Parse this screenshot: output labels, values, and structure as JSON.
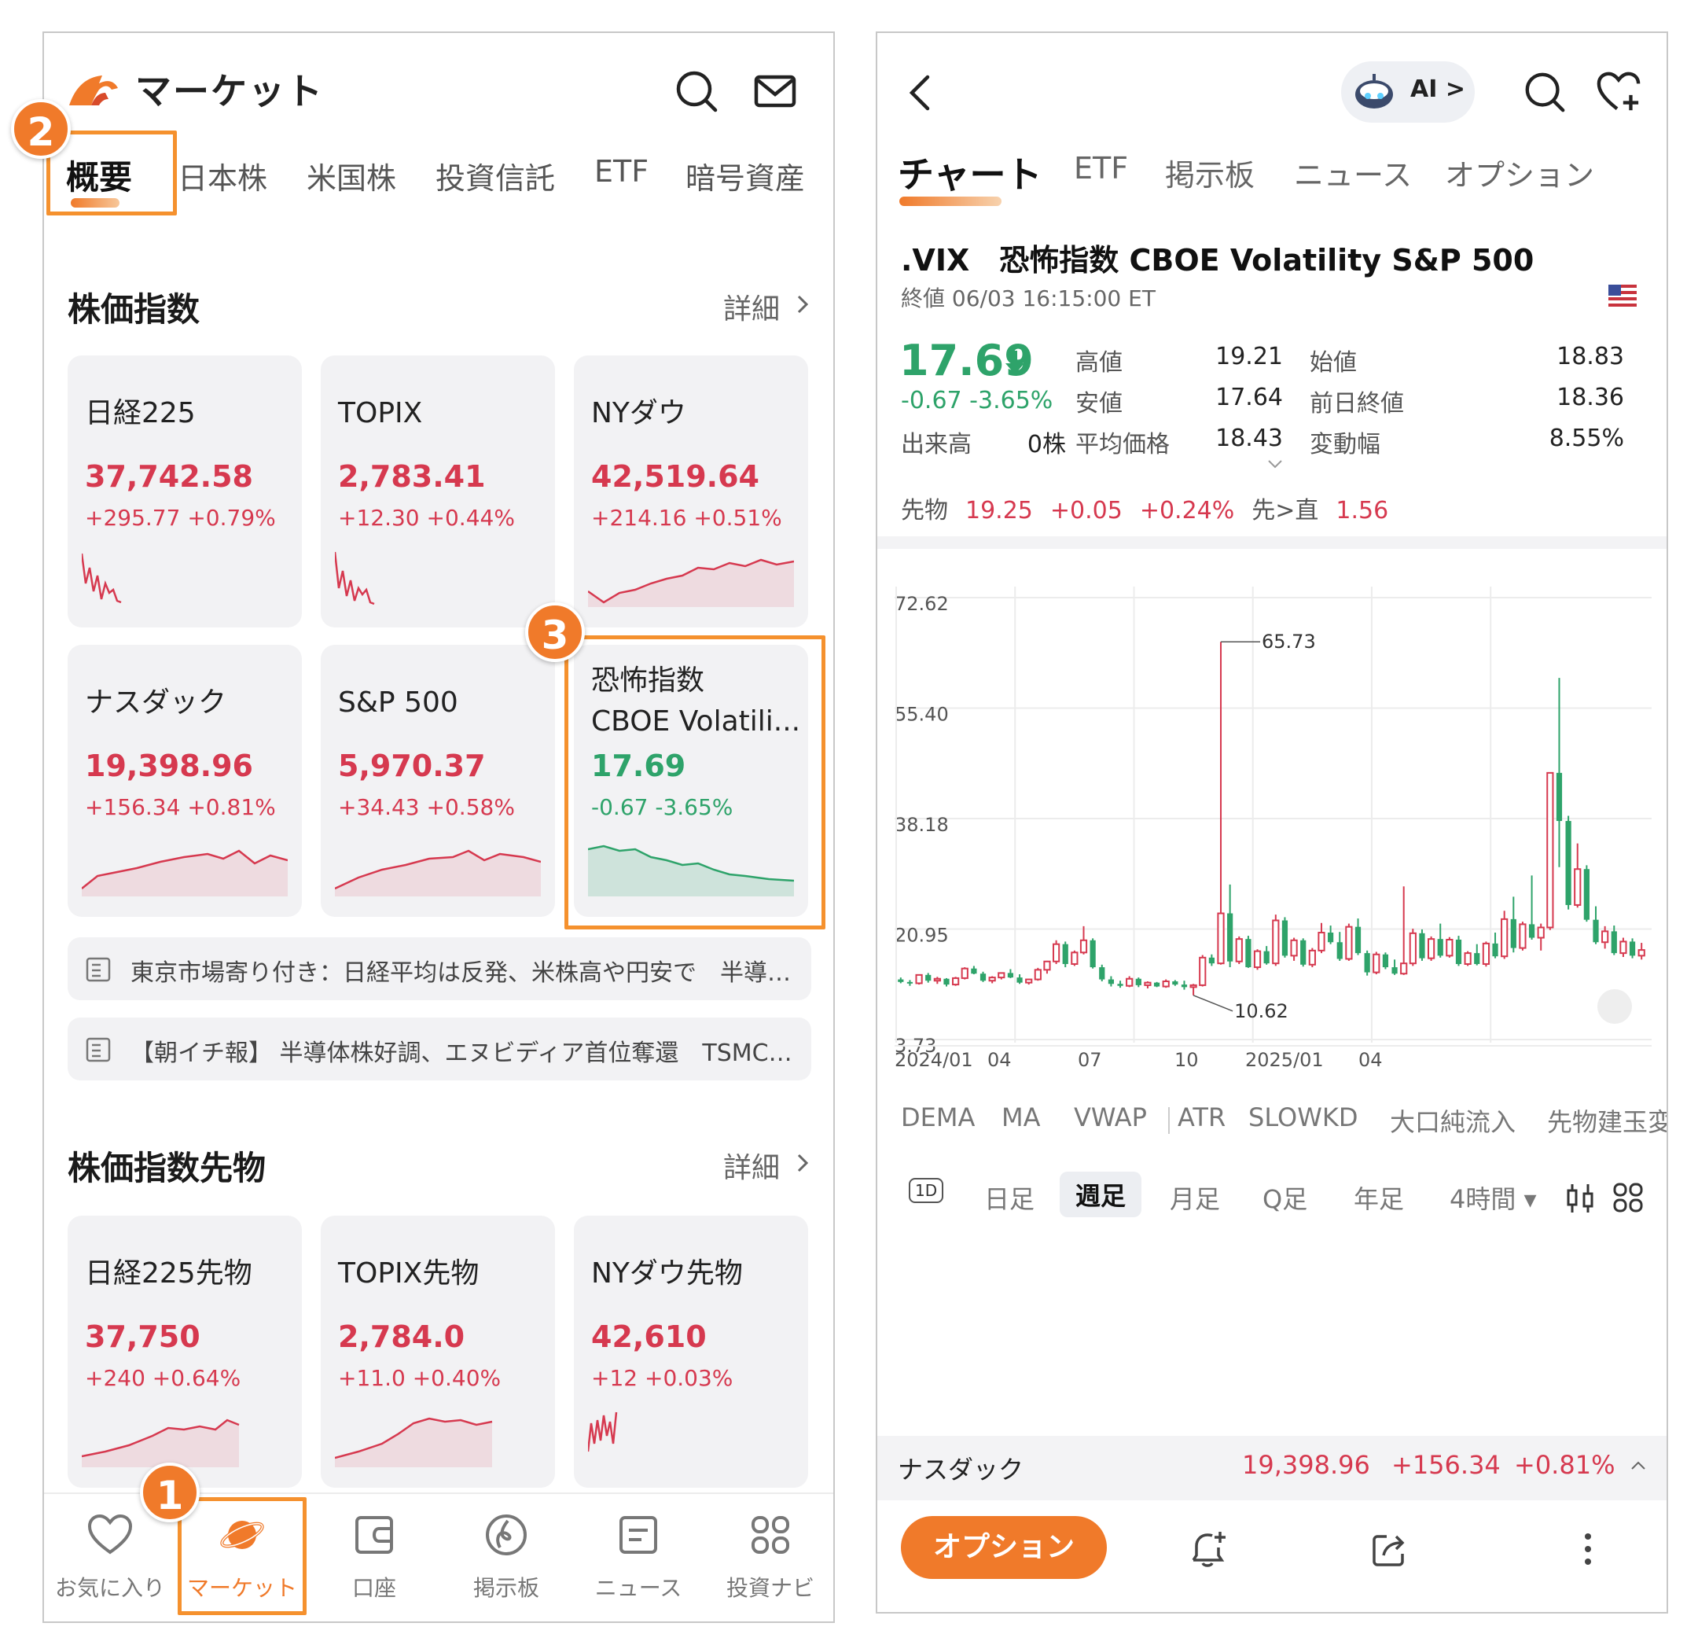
{
  "left": {
    "header": {
      "title": "マーケット"
    },
    "tabs": [
      "概要",
      "日本株",
      "米国株",
      "投資信託",
      "ETF",
      "暗号資産"
    ],
    "indices_section": {
      "title": "株価指数",
      "detail": "詳細"
    },
    "indices": [
      {
        "name": "日経225",
        "price": "37,742.58",
        "change": "+295.77 +0.79%",
        "dir": "up"
      },
      {
        "name": "TOPIX",
        "price": "2,783.41",
        "change": "+12.30 +0.44%",
        "dir": "up"
      },
      {
        "name": "NYダウ",
        "price": "42,519.64",
        "change": "+214.16 +0.51%",
        "dir": "up"
      },
      {
        "name": "ナスダック",
        "price": "19,398.96",
        "change": "+156.34 +0.81%",
        "dir": "up"
      },
      {
        "name": "S&P 500",
        "price": "5,970.37",
        "change": "+34.43 +0.58%",
        "dir": "up"
      },
      {
        "name": "恐怖指数",
        "name2": "CBOE Volatili...",
        "price": "17.69",
        "change": "-0.67 -3.65%",
        "dir": "down"
      }
    ],
    "news": [
      "東京市場寄り付き：日経平均は反発、米株高や円安で　半導…",
      "【朝イチ報】 半導体株好調、エヌビディア首位奪還　TSMC…"
    ],
    "futures_section": {
      "title": "株価指数先物",
      "detail": "詳細"
    },
    "futures": [
      {
        "name": "日経225先物",
        "price": "37,750",
        "change": "+240 +0.64%"
      },
      {
        "name": "TOPIX先物",
        "price": "2,784.0",
        "change": "+11.0 +0.40%"
      },
      {
        "name": "NYダウ先物",
        "price": "42,610",
        "change": "+12 +0.03%"
      }
    ],
    "nav": [
      "お気に入り",
      "マーケット",
      "口座",
      "掲示板",
      "ニュース",
      "投資ナビ"
    ],
    "badges": [
      "1",
      "2",
      "3"
    ]
  },
  "right": {
    "ai_label": "AI >",
    "tabs": [
      "チャート",
      "ETF",
      "掲示板",
      "ニュース",
      "オプション"
    ],
    "symbol_title": ".VIX　恐怖指数 CBOE Volatility S&P 500",
    "close_time": "終値 06/03 16:15:00 ET",
    "price": "17.69",
    "change": "-0.67 -3.65%",
    "stats": {
      "high_label": "高値",
      "high": "19.21",
      "open_label": "始値",
      "open": "18.83",
      "low_label": "安値",
      "low": "17.64",
      "prev_label": "前日終値",
      "prev": "18.36",
      "vol_label": "出来高",
      "vol": "0株",
      "avg_label": "平均価格",
      "avg": "18.43",
      "range_label": "変動幅",
      "range": "8.55%"
    },
    "futures_row": {
      "label": "先物",
      "price": "19.25",
      "chg": "+0.05",
      "pct": "+0.24%",
      "spread_label": "先>直",
      "spread": "1.56"
    },
    "indicators": [
      "DEMA",
      "MA",
      "VWAP",
      "ATR",
      "SLOWKD",
      "大口純流入",
      "先物建玉変"
    ],
    "periods": [
      "1D",
      "日足",
      "週足",
      "月足",
      "Q足",
      "年足",
      "4時間 ▾"
    ],
    "ticker": {
      "name": "ナスダック",
      "price": "19,398.96",
      "chg": "+156.34",
      "pct": "+0.81%"
    },
    "option_button": "オプション"
  },
  "chart_data": {
    "type": "candlestick",
    "title": "",
    "y_ticks": [
      "72.62",
      "55.40",
      "38.18",
      "20.95",
      "3.73"
    ],
    "x_ticks": [
      "2024/01",
      "04",
      "07",
      "10",
      "2025/01",
      "04"
    ],
    "ylim": [
      3.73,
      72.62
    ],
    "annotations": [
      {
        "label": "65.73",
        "value": 65.73
      },
      {
        "label": "10.62",
        "value": 10.62
      }
    ],
    "grid": true,
    "candles": [
      [
        13.1,
        13.4,
        12.5,
        12.7
      ],
      [
        12.7,
        13.0,
        12.1,
        12.5
      ],
      [
        12.5,
        13.9,
        12.3,
        13.8
      ],
      [
        13.8,
        14.1,
        12.6,
        12.9
      ],
      [
        12.9,
        13.5,
        12.4,
        13.2
      ],
      [
        13.2,
        13.3,
        12.0,
        12.3
      ],
      [
        12.3,
        13.5,
        12.1,
        13.3
      ],
      [
        13.3,
        15.0,
        13.1,
        14.8
      ],
      [
        14.8,
        15.2,
        13.9,
        14.0
      ],
      [
        14.0,
        14.3,
        12.7,
        12.9
      ],
      [
        12.9,
        13.6,
        12.5,
        13.4
      ],
      [
        13.4,
        14.2,
        13.1,
        14.1
      ],
      [
        14.1,
        14.7,
        13.3,
        13.4
      ],
      [
        13.4,
        13.9,
        12.4,
        12.6
      ],
      [
        12.6,
        13.2,
        12.3,
        13.1
      ],
      [
        13.1,
        14.9,
        12.9,
        14.6
      ],
      [
        14.6,
        16.0,
        14.0,
        15.9
      ],
      [
        15.9,
        19.2,
        15.5,
        18.6
      ],
      [
        18.6,
        19.0,
        15.0,
        15.5
      ],
      [
        15.5,
        17.6,
        15.2,
        17.3
      ],
      [
        17.3,
        21.4,
        17.0,
        19.2
      ],
      [
        19.2,
        19.5,
        14.8,
        15.0
      ],
      [
        15.0,
        15.4,
        12.8,
        13.1
      ],
      [
        13.1,
        13.6,
        12.0,
        12.4
      ],
      [
        12.4,
        12.9,
        11.8,
        12.1
      ],
      [
        12.1,
        13.6,
        11.9,
        13.2
      ],
      [
        13.2,
        13.4,
        11.9,
        12.2
      ],
      [
        12.2,
        12.8,
        11.7,
        12.6
      ],
      [
        12.6,
        12.7,
        11.9,
        12.0
      ],
      [
        12.0,
        13.1,
        11.8,
        12.8
      ],
      [
        12.8,
        13.0,
        12.1,
        12.3
      ],
      [
        12.3,
        12.9,
        11.5,
        11.9
      ],
      [
        11.9,
        12.4,
        10.62,
        12.2
      ],
      [
        12.2,
        16.9,
        12.0,
        16.5
      ],
      [
        16.5,
        17.0,
        15.2,
        15.6
      ],
      [
        15.6,
        65.73,
        15.4,
        23.4
      ],
      [
        23.4,
        27.9,
        15.0,
        15.9
      ],
      [
        15.9,
        19.8,
        15.5,
        19.4
      ],
      [
        19.4,
        19.9,
        14.9,
        15.0
      ],
      [
        15.0,
        17.8,
        14.6,
        17.5
      ],
      [
        17.5,
        18.3,
        15.4,
        15.6
      ],
      [
        15.6,
        23.2,
        15.2,
        22.3
      ],
      [
        22.3,
        22.8,
        16.5,
        16.8
      ],
      [
        16.8,
        19.6,
        16.0,
        19.2
      ],
      [
        19.2,
        19.5,
        15.1,
        15.4
      ],
      [
        15.4,
        18.0,
        15.0,
        17.6
      ],
      [
        17.6,
        21.9,
        17.2,
        20.4
      ],
      [
        20.4,
        21.5,
        18.6,
        18.9
      ],
      [
        18.9,
        20.5,
        16.0,
        16.3
      ],
      [
        16.3,
        21.8,
        16.0,
        21.3
      ],
      [
        21.3,
        22.6,
        16.9,
        17.2
      ],
      [
        17.2,
        17.6,
        13.7,
        14.2
      ],
      [
        14.2,
        17.4,
        13.9,
        17.0
      ],
      [
        17.0,
        17.3,
        14.7,
        15.0
      ],
      [
        15.0,
        16.2,
        13.8,
        14.0
      ],
      [
        14.0,
        27.6,
        13.8,
        15.6
      ],
      [
        15.6,
        21.0,
        15.2,
        20.3
      ],
      [
        20.3,
        20.9,
        16.0,
        16.4
      ],
      [
        16.4,
        19.8,
        16.0,
        19.4
      ],
      [
        19.4,
        21.8,
        16.5,
        16.8
      ],
      [
        16.8,
        19.7,
        16.5,
        19.3
      ],
      [
        19.3,
        19.9,
        15.2,
        15.5
      ],
      [
        15.5,
        17.5,
        15.2,
        17.2
      ],
      [
        17.2,
        18.6,
        15.3,
        15.5
      ],
      [
        15.5,
        19.0,
        15.1,
        18.7
      ],
      [
        18.7,
        20.4,
        16.4,
        16.7
      ],
      [
        16.7,
        23.8,
        16.3,
        22.5
      ],
      [
        22.5,
        26.0,
        17.3,
        18.0
      ],
      [
        18.0,
        22.1,
        17.6,
        21.7
      ],
      [
        21.7,
        29.3,
        19.3,
        19.6
      ],
      [
        19.6,
        21.8,
        17.6,
        21.2
      ],
      [
        21.2,
        45.3,
        20.8,
        45.3
      ],
      [
        45.3,
        60.1,
        30.6,
        37.8
      ],
      [
        37.8,
        38.6,
        24.0,
        24.7
      ],
      [
        24.7,
        34.3,
        24.3,
        30.3
      ],
      [
        30.3,
        30.9,
        22.1,
        22.4
      ],
      [
        22.4,
        24.5,
        18.6,
        18.9
      ],
      [
        18.9,
        21.4,
        17.9,
        20.6
      ],
      [
        20.6,
        21.5,
        16.9,
        17.2
      ],
      [
        17.2,
        19.6,
        16.6,
        19.0
      ],
      [
        19.0,
        19.5,
        16.4,
        16.8
      ],
      [
        16.8,
        18.8,
        16.2,
        17.69
      ]
    ]
  }
}
